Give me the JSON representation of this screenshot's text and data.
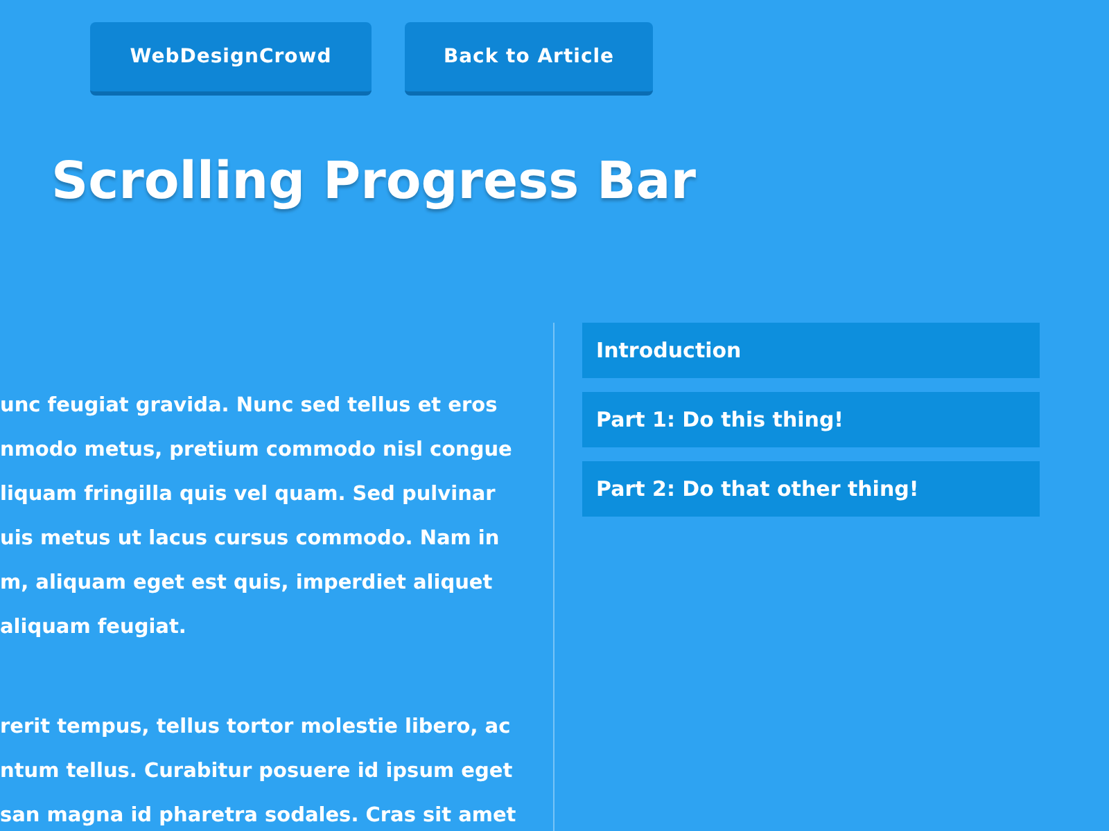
{
  "header_buttons": [
    "WebDesignCrowd",
    "Back to Article"
  ],
  "title": "Scrolling Progress Bar",
  "article": {
    "paragraphs": [
      [
        "unc feugiat gravida. Nunc sed tellus et eros",
        "nmodo metus, pretium commodo nisl congue",
        "liquam fringilla quis vel quam. Sed pulvinar",
        "uis metus ut lacus cursus commodo. Nam in",
        "m, aliquam eget est quis, imperdiet aliquet",
        "aliquam feugiat."
      ],
      [
        "rerit tempus, tellus tortor molestie libero, ac",
        "ntum tellus. Curabitur posuere id ipsum eget",
        "san magna id pharetra sodales. Cras sit amet"
      ]
    ]
  },
  "toc": [
    "Introduction",
    "Part 1: Do this thing!",
    "Part 2: Do that other thing!"
  ]
}
